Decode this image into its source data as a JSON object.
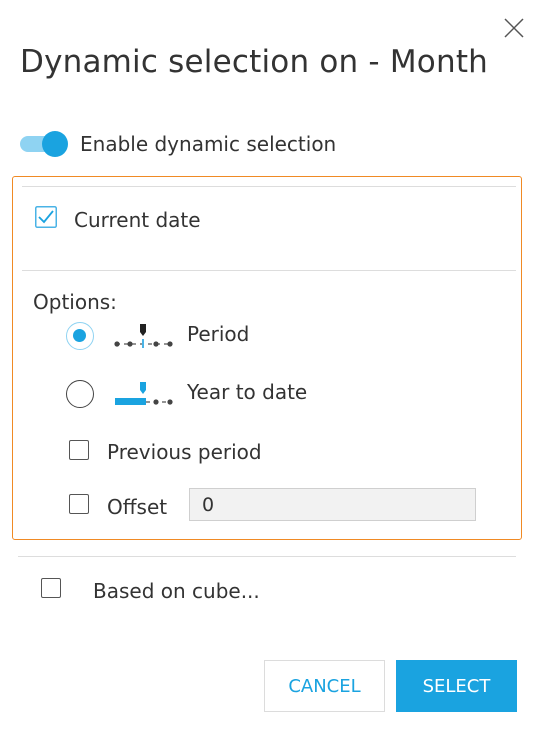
{
  "dialog": {
    "title": "Dynamic selection on - Month",
    "close_icon": "close-icon"
  },
  "toggle": {
    "label": "Enable dynamic selection",
    "on": true,
    "color": "#1aa3e0"
  },
  "current_date": {
    "label": "Current date",
    "checked": true
  },
  "options": {
    "heading": "Options:",
    "period": {
      "label": "Period",
      "selected": true,
      "icon": "period-timeline-icon"
    },
    "year_to_date": {
      "label": "Year to date",
      "selected": false,
      "icon": "year-to-date-timeline-icon"
    },
    "previous_period": {
      "label": "Previous period",
      "checked": false
    },
    "offset": {
      "label": "Offset",
      "checked": false,
      "value": "0"
    }
  },
  "based_on_cube": {
    "label": "Based on cube...",
    "checked": false
  },
  "buttons": {
    "cancel": "CANCEL",
    "select": "SELECT"
  },
  "colors": {
    "accent": "#1aa3e0",
    "highlight_border": "#f08a24"
  }
}
